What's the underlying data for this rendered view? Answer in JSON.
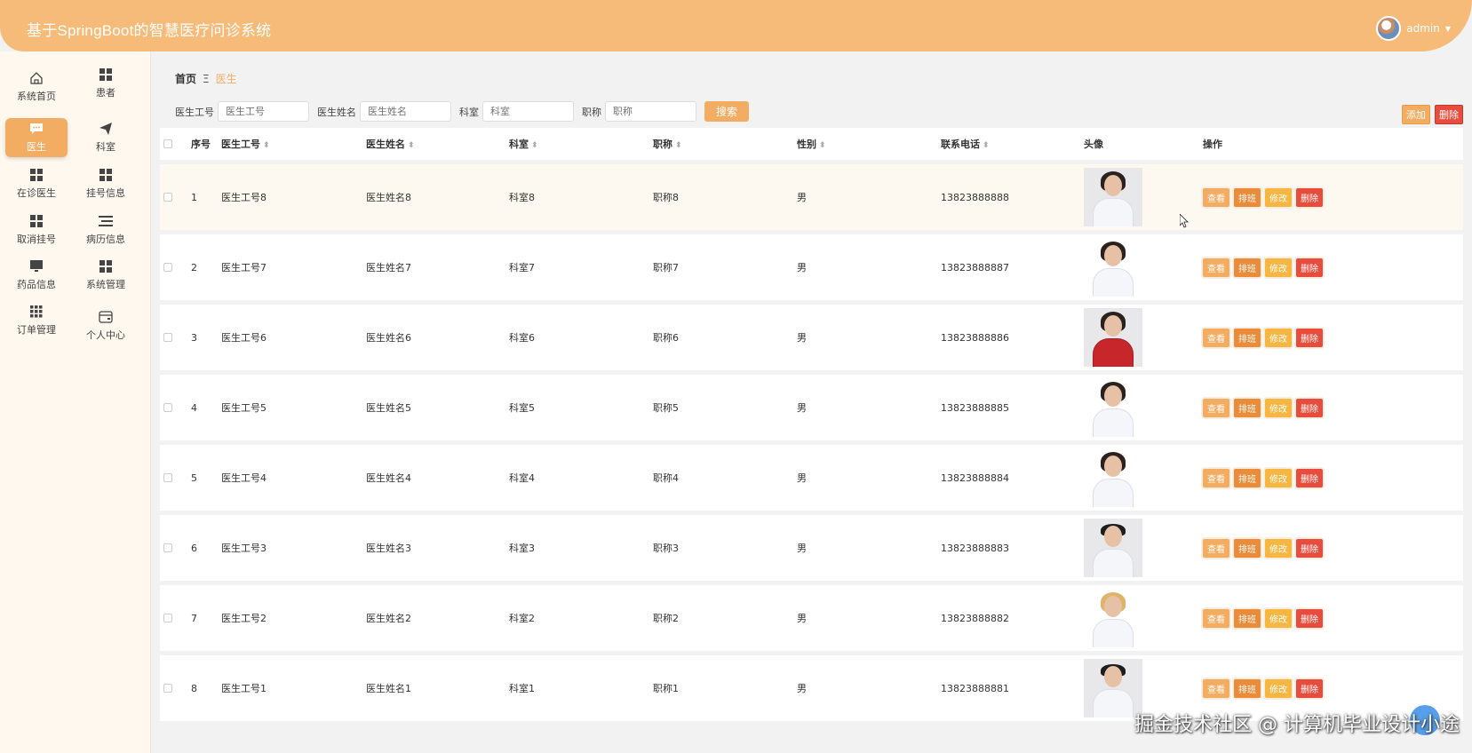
{
  "app": {
    "title": "基于SpringBoot的智慧医疗问诊系统",
    "user": "admin"
  },
  "sidebar": {
    "items": [
      {
        "label": "系统首页",
        "icon": "home-icon"
      },
      {
        "label": "患者",
        "icon": "grid-icon"
      },
      {
        "label": "医生",
        "icon": "chat-icon",
        "active": true
      },
      {
        "label": "科室",
        "icon": "send-icon"
      },
      {
        "label": "在诊医生",
        "icon": "grid-icon"
      },
      {
        "label": "挂号信息",
        "icon": "grid-icon"
      },
      {
        "label": "取消挂号",
        "icon": "grid-icon"
      },
      {
        "label": "病历信息",
        "icon": "list-icon"
      },
      {
        "label": "药品信息",
        "icon": "monitor-icon"
      },
      {
        "label": "系统管理",
        "icon": "grid-icon"
      },
      {
        "label": "订单管理",
        "icon": "apps-icon"
      },
      {
        "label": "个人中心",
        "icon": "wallet-icon"
      }
    ]
  },
  "breadcrumb": {
    "home": "首页",
    "sep": "Ξ",
    "current": "医生"
  },
  "search": {
    "fields": [
      {
        "label": "医生工号",
        "placeholder": "医生工号"
      },
      {
        "label": "医生姓名",
        "placeholder": "医生姓名"
      },
      {
        "label": "科室",
        "placeholder": "科室"
      },
      {
        "label": "职称",
        "placeholder": "职称"
      }
    ],
    "button": "搜索"
  },
  "actions": {
    "add": "添加",
    "delete": "删除"
  },
  "table": {
    "headers": [
      "序号",
      "医生工号",
      "医生姓名",
      "科室",
      "职称",
      "性别",
      "联系电话",
      "头像",
      "操作"
    ],
    "op_labels": {
      "view": "查看",
      "schedule": "排班",
      "edit": "修改",
      "delete": "删除"
    },
    "rows": [
      {
        "idx": "1",
        "no": "医生工号8",
        "name": "医生姓名8",
        "dept": "科室8",
        "title": "职称8",
        "sex": "男",
        "phone": "13823888888"
      },
      {
        "idx": "2",
        "no": "医生工号7",
        "name": "医生姓名7",
        "dept": "科室7",
        "title": "职称7",
        "sex": "男",
        "phone": "13823888887"
      },
      {
        "idx": "3",
        "no": "医生工号6",
        "name": "医生姓名6",
        "dept": "科室6",
        "title": "职称6",
        "sex": "男",
        "phone": "13823888886"
      },
      {
        "idx": "4",
        "no": "医生工号5",
        "name": "医生姓名5",
        "dept": "科室5",
        "title": "职称5",
        "sex": "男",
        "phone": "13823888885"
      },
      {
        "idx": "5",
        "no": "医生工号4",
        "name": "医生姓名4",
        "dept": "科室4",
        "title": "职称4",
        "sex": "男",
        "phone": "13823888884"
      },
      {
        "idx": "6",
        "no": "医生工号3",
        "name": "医生姓名3",
        "dept": "科室3",
        "title": "职称3",
        "sex": "男",
        "phone": "13823888883"
      },
      {
        "idx": "7",
        "no": "医生工号2",
        "name": "医生姓名2",
        "dept": "科室2",
        "title": "职称2",
        "sex": "男",
        "phone": "13823888882"
      },
      {
        "idx": "8",
        "no": "医生工号1",
        "name": "医生姓名1",
        "dept": "科室1",
        "title": "职称1",
        "sex": "男",
        "phone": "13823888881"
      }
    ]
  },
  "watermark": "掘金技术社区 @ 计算机毕业设计小途",
  "colors": {
    "accent": "#f3ad62",
    "header": "#f7bb79",
    "danger": "#e74c3c"
  }
}
